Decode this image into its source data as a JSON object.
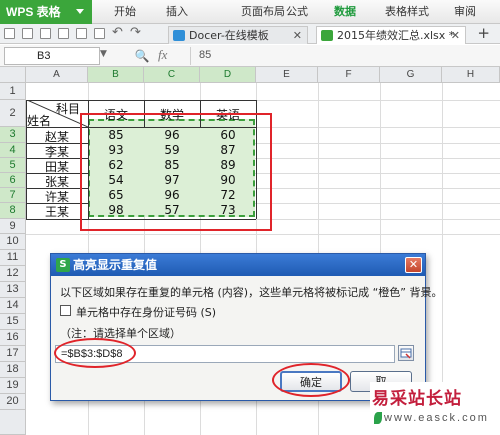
{
  "app": {
    "name": "WPS 表格"
  },
  "menu": [
    "开始",
    "插入",
    "页面布局",
    "公式",
    "数据",
    "表格样式",
    "审阅"
  ],
  "menu_active": "数据",
  "tabs": [
    {
      "label": "Docer-在线模板",
      "icon_color": "#2f8fd8"
    },
    {
      "label": "2015年绩效汇总.xlsx *",
      "icon_color": "#3ba63b"
    }
  ],
  "formula_bar": {
    "cell_ref": "B3",
    "fx": "fx",
    "content": "85"
  },
  "sheet": {
    "columns": [
      "A",
      "B",
      "C",
      "D",
      "E",
      "F",
      "G",
      "H"
    ],
    "rows": [
      "1",
      "2",
      "3",
      "4",
      "5",
      "6",
      "7",
      "8",
      "9",
      "10",
      "11",
      "12",
      "13",
      "14",
      "15",
      "16",
      "17",
      "18",
      "19",
      "20"
    ],
    "header_top": "科目",
    "header_bottom": "姓名",
    "subjects": [
      "语文",
      "数学",
      "英语"
    ],
    "names": [
      "赵某",
      "李某",
      "田某",
      "张某",
      "许某",
      "王某"
    ],
    "scores": [
      [
        "85",
        "96",
        "60"
      ],
      [
        "93",
        "59",
        "87"
      ],
      [
        "62",
        "85",
        "89"
      ],
      [
        "54",
        "97",
        "90"
      ],
      [
        "65",
        "96",
        "72"
      ],
      [
        "98",
        "57",
        "73"
      ]
    ]
  },
  "dialog": {
    "title": "高亮显示重复值",
    "close": "✕",
    "description": "以下区域如果存在重复的单元格 (内容)，这些单元格将被标记成 “橙色” 背景。",
    "checkbox_label": "单元格中存在身份证号码 (S)",
    "note": "（注：请选择单个区域）",
    "range": "=$B$3:$D$8",
    "ok": "确定",
    "cancel": "取"
  },
  "watermark": {
    "main": "易采站长站",
    "sub": "www.easck.com"
  },
  "colors": {
    "accent_green": "#3ba63b",
    "annotation_red": "#e0242a",
    "dialog_blue": "#1f5bb3"
  }
}
